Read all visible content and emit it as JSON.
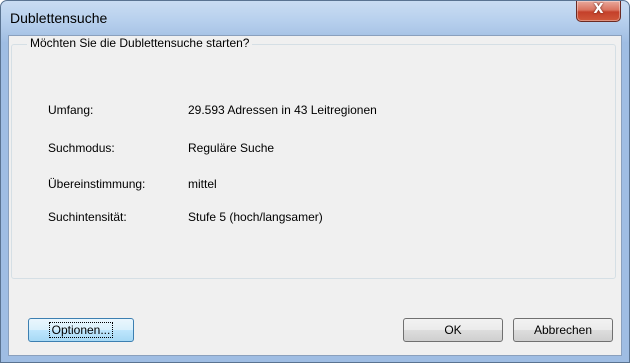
{
  "window": {
    "title": "Dublettensuche",
    "close_glyph": "X"
  },
  "group": {
    "legend": "Möchten Sie die Dublettensuche starten?",
    "rows": [
      {
        "label": "Umfang:",
        "value": "29.593 Adressen in 43 Leitregionen"
      },
      {
        "label": "Suchmodus:",
        "value": "Reguläre Suche"
      },
      {
        "label": "Übereinstimmung:",
        "value": "mittel"
      },
      {
        "label": "Suchintensität:",
        "value": "Stufe 5 (hoch/langsamer)"
      }
    ]
  },
  "buttons": {
    "options": "Optionen...",
    "ok": "OK",
    "cancel": "Abbrechen"
  }
}
